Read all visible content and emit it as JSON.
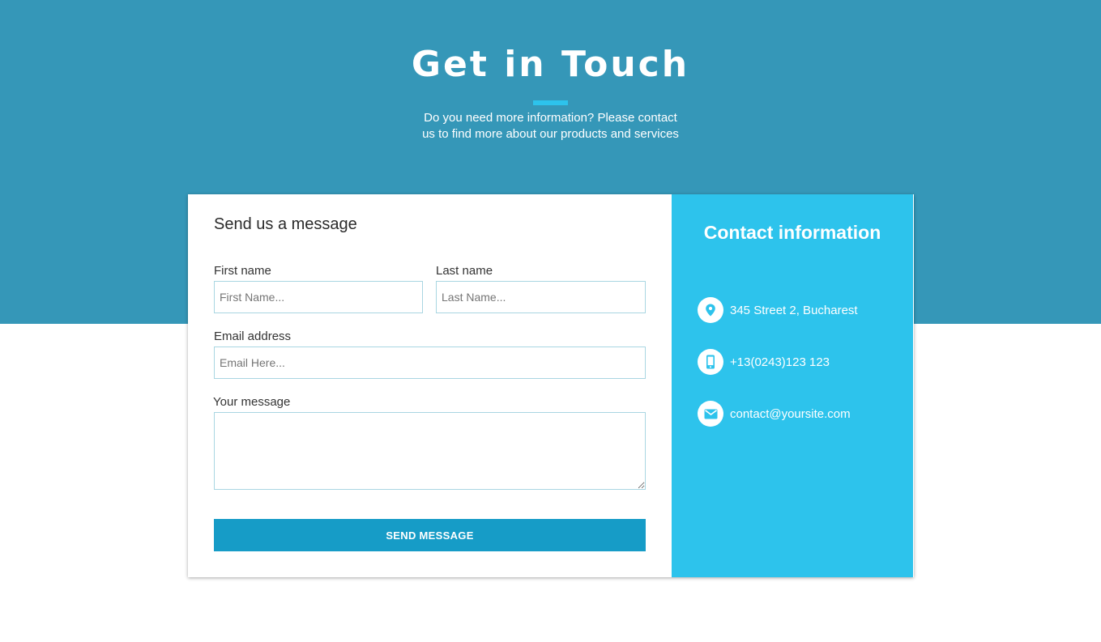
{
  "hero": {
    "title": "Get in Touch",
    "subtitle_line1": "Do you need more information? Please contact",
    "subtitle_line2": "us to find more about our products and services"
  },
  "form": {
    "heading": "Send us a message",
    "first_name": {
      "label": "First name",
      "placeholder": "First Name..."
    },
    "last_name": {
      "label": "Last name",
      "placeholder": "Last Name..."
    },
    "email": {
      "label": "Email address",
      "placeholder": "Email Here..."
    },
    "message": {
      "label": "Your message",
      "value": ""
    },
    "submit_label": "SEND MESSAGE"
  },
  "contact": {
    "heading": "Contact information",
    "items": [
      {
        "icon": "location-pin-icon",
        "text": "345 Street 2, Bucharest"
      },
      {
        "icon": "mobile-phone-icon",
        "text": "+13(0243)123 123"
      },
      {
        "icon": "envelope-icon",
        "text": "contact@yoursite.com"
      }
    ]
  },
  "colors": {
    "hero_background": "#3597b8",
    "accent": "#2dc3ec",
    "button": "#169cc7",
    "input_border": "#a9d6e2"
  }
}
